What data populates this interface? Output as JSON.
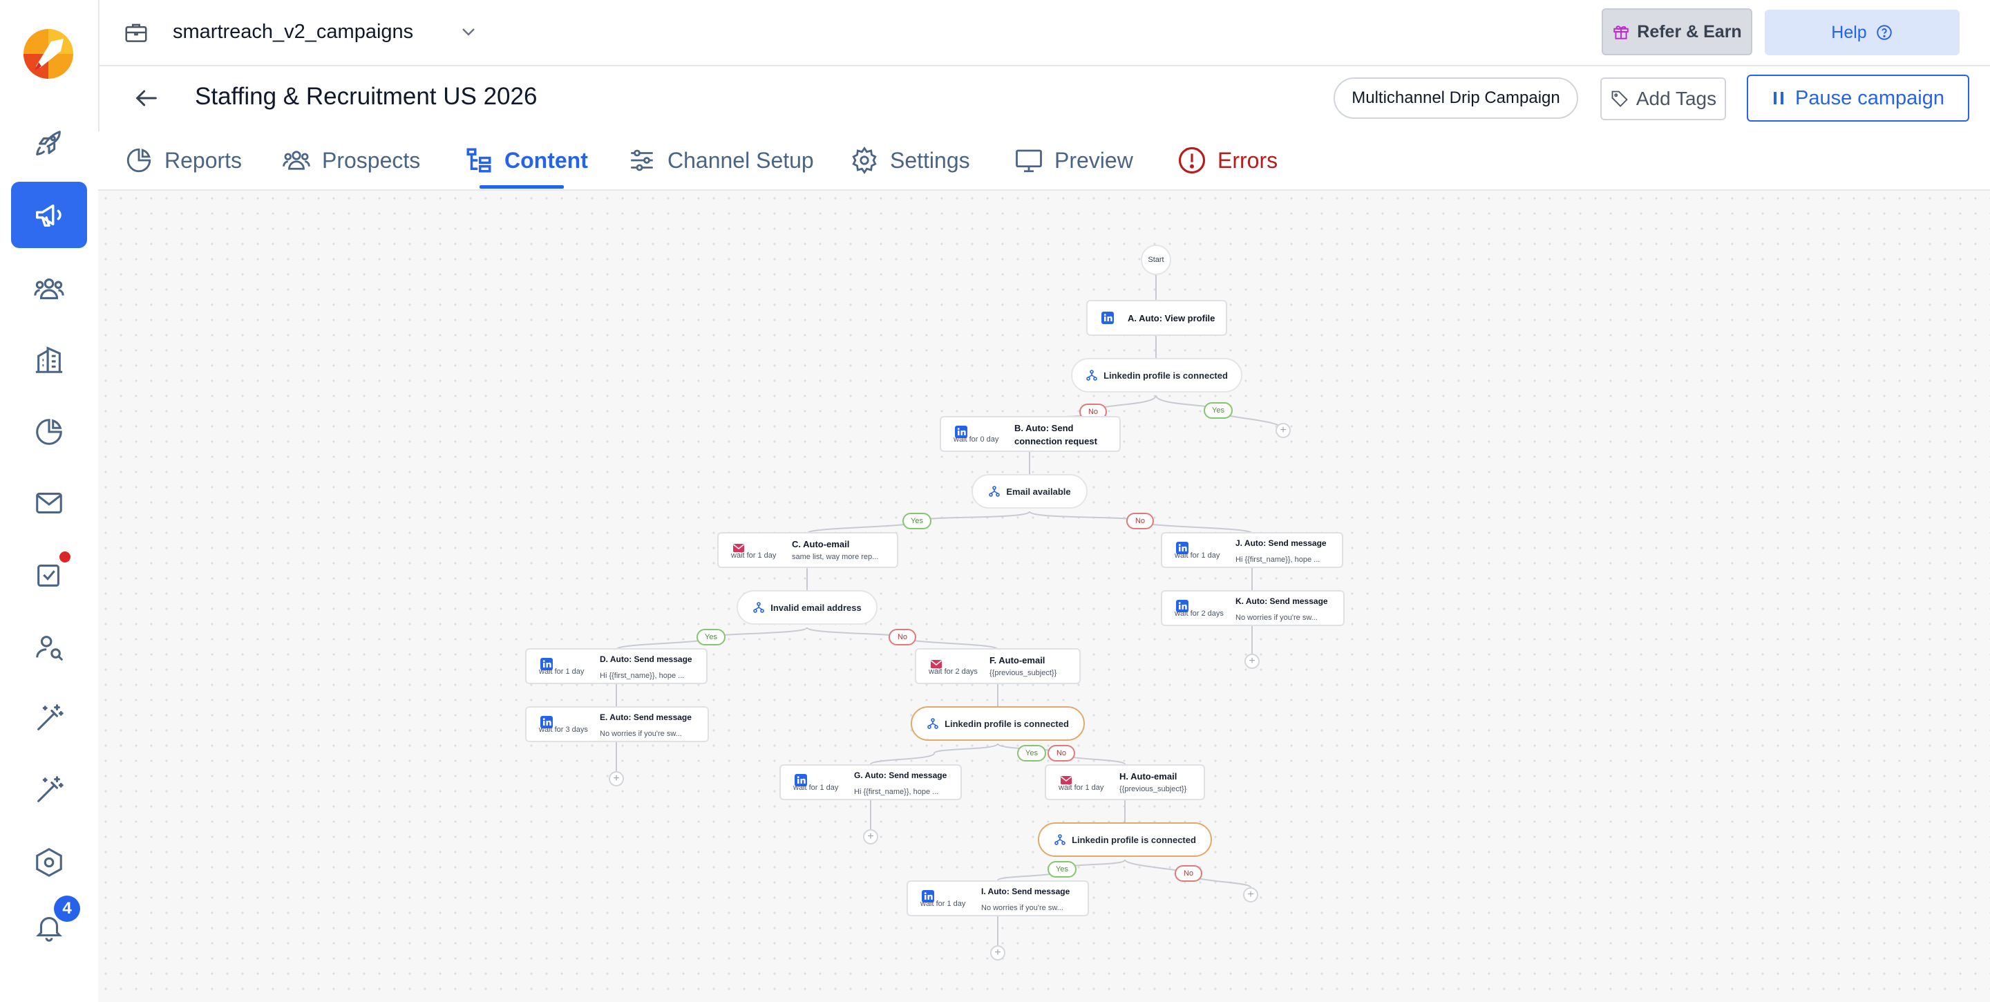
{
  "workspace": {
    "name": "smartreach_v2_campaigns"
  },
  "top_actions": {
    "refer_label": "Refer & Earn",
    "help_label": "Help"
  },
  "campaign": {
    "title": "Staffing & Recruitment US 2026",
    "type_label": "Multichannel Drip Campaign",
    "add_tags_label": "Add Tags",
    "pause_label": "Pause campaign"
  },
  "tabs": [
    {
      "label": "Reports",
      "icon": "pie-chart-icon"
    },
    {
      "label": "Prospects",
      "icon": "users-icon"
    },
    {
      "label": "Content",
      "icon": "flow-tree-icon",
      "active": true
    },
    {
      "label": "Channel Setup",
      "icon": "sliders-icon"
    },
    {
      "label": "Settings",
      "icon": "gear-icon"
    },
    {
      "label": "Preview",
      "icon": "monitor-icon"
    },
    {
      "label": "Errors",
      "icon": "error-circle-icon"
    }
  ],
  "sidebar": {
    "items": [
      {
        "icon": "rocket-icon"
      },
      {
        "icon": "megaphone-icon",
        "active": true
      },
      {
        "icon": "users-icon"
      },
      {
        "icon": "building-icon"
      },
      {
        "icon": "pie-chart-icon"
      },
      {
        "icon": "mail-icon"
      },
      {
        "icon": "task-check-icon",
        "has_dot": true
      },
      {
        "icon": "user-search-icon"
      },
      {
        "icon": "magic-wand-icon"
      },
      {
        "icon": "magic-wand-icon"
      },
      {
        "icon": "hexagon-settings-icon"
      },
      {
        "icon": "bell-icon",
        "badge": "4"
      }
    ]
  },
  "flow": {
    "start_label": "Start",
    "plus_label": "+",
    "yes_label": "Yes",
    "no_label": "No",
    "steps": {
      "A": {
        "title": "A. Auto: View profile",
        "channel": "linkedin"
      },
      "B": {
        "title": "B. Auto: Send connection request",
        "wait": "wait for 0 day",
        "channel": "linkedin"
      },
      "C": {
        "title": "C. Auto-email",
        "subtitle": "same list, way more rep...",
        "wait": "wait for 1 day",
        "channel": "email"
      },
      "D": {
        "title": "D. Auto: Send message",
        "subtitle": "Hi {{first_name}}, hope ...",
        "wait": "wait for 1 day",
        "channel": "linkedin"
      },
      "E": {
        "title": "E. Auto: Send message",
        "subtitle": "No worries if you're sw...",
        "wait": "wait for 3 days",
        "channel": "linkedin"
      },
      "F": {
        "title": "F. Auto-email",
        "subtitle": "{{previous_subject}}",
        "wait": "wait for 2 days",
        "channel": "email"
      },
      "G": {
        "title": "G. Auto: Send message",
        "subtitle": "Hi {{first_name}}, hope ...",
        "wait": "wait for 1 day",
        "channel": "linkedin"
      },
      "H": {
        "title": "H. Auto-email",
        "subtitle": "{{previous_subject}}",
        "wait": "wait for 1 day",
        "channel": "email"
      },
      "I": {
        "title": "I. Auto: Send message",
        "subtitle": "No worries if you're sw...",
        "wait": "wait for 1 day",
        "channel": "linkedin"
      },
      "J": {
        "title": "J. Auto: Send message",
        "subtitle": "Hi {{first_name}}, hope ...",
        "wait": "wait for 1 day",
        "channel": "linkedin"
      },
      "K": {
        "title": "K. Auto: Send message",
        "subtitle": "No worries if you're sw...",
        "wait": "wait for 2 days",
        "channel": "linkedin"
      }
    },
    "conditions": {
      "c1": "Linkedin profile is connected",
      "c2": "Email available",
      "c3": "Invalid email address",
      "c4": "Linkedin profile is connected",
      "c5": "Linkedin profile is connected"
    }
  },
  "colors": {
    "accent": "#2563eb",
    "error": "#b91c1c",
    "yes": "#4d8f33",
    "no": "#c23030",
    "highlight_border": "#e0a968"
  }
}
